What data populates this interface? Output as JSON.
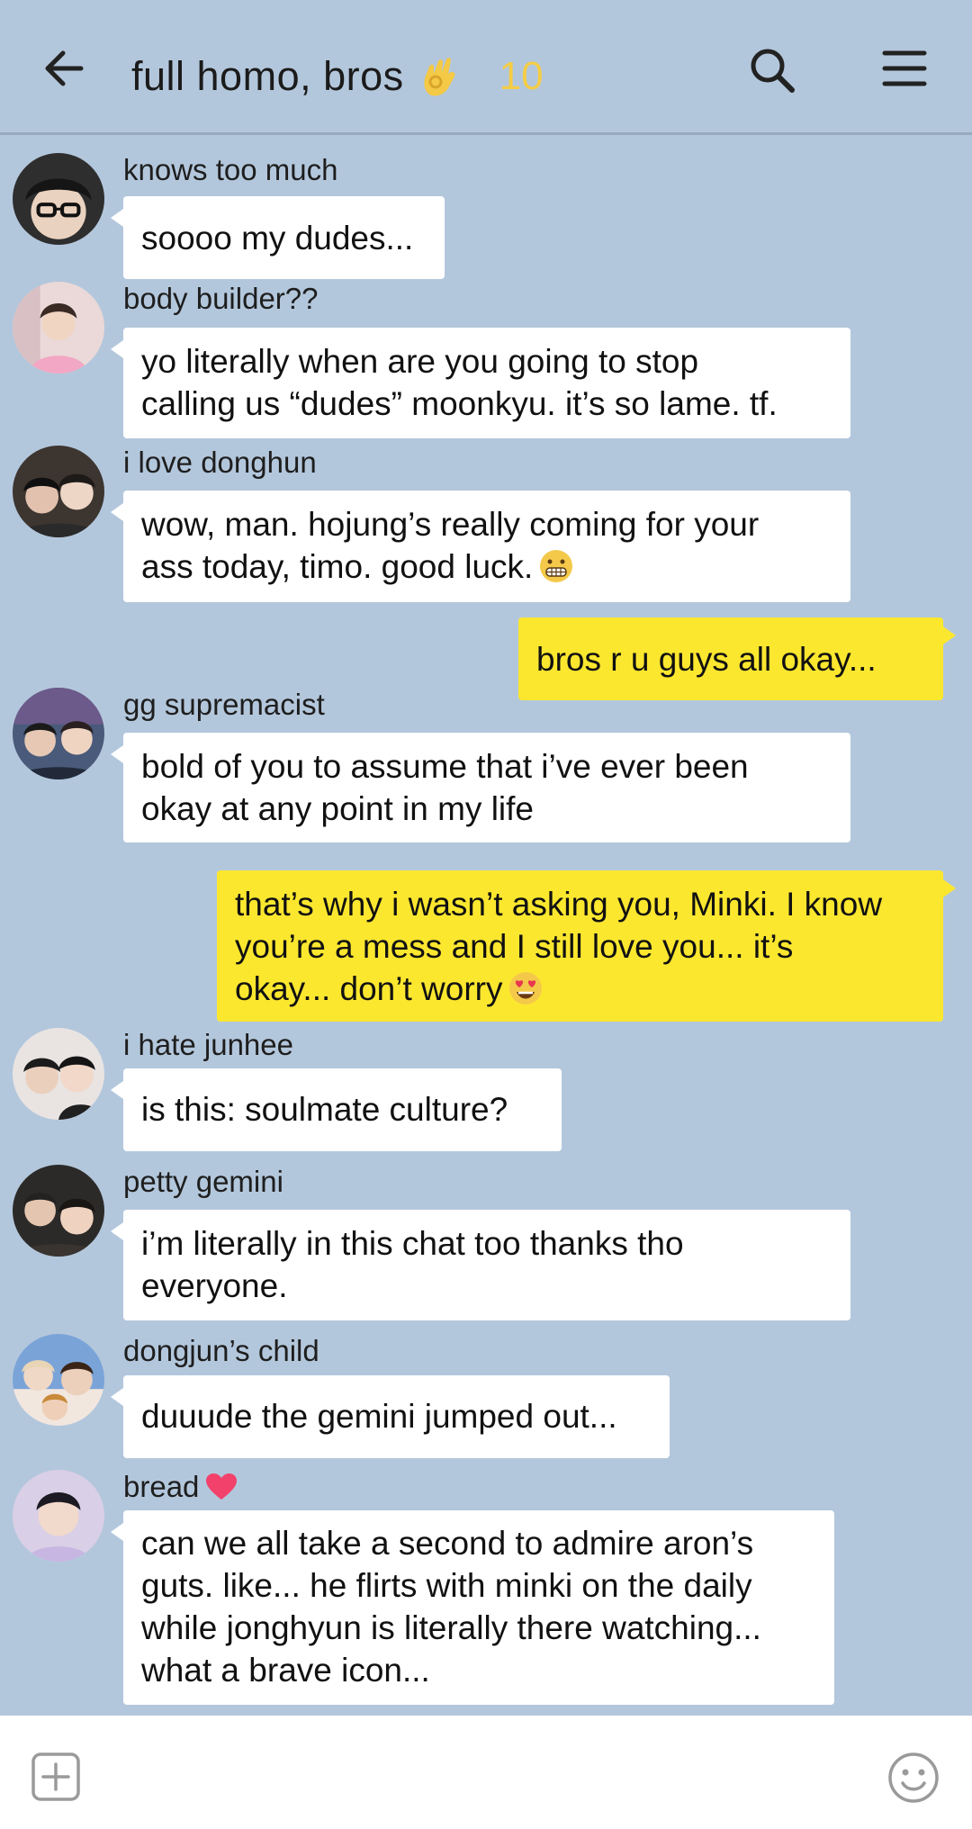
{
  "header": {
    "title": "full homo, bros",
    "member_count": "10",
    "back_icon": "arrow-left-icon",
    "search_icon": "search-icon",
    "menu_icon": "hamburger-menu-icon",
    "accent_color": "#f5cd45"
  },
  "colors": {
    "background": "#b3c7dc",
    "incoming_bubble": "#ffffff",
    "outgoing_bubble": "#fce72f"
  },
  "messages": [
    {
      "sender": "knows too much",
      "lines": [
        "soooo my dudes..."
      ]
    },
    {
      "sender": "body builder??",
      "lines": [
        "yo literally when are you going to stop",
        "calling us “dudes” moonkyu. it’s so lame. tf."
      ]
    },
    {
      "sender": "i love donghun",
      "lines": [
        "wow, man. hojung’s really coming for your",
        "ass today, timo. good luck."
      ]
    },
    {
      "outgoing": true,
      "lines": [
        "bros r u guys all okay..."
      ]
    },
    {
      "sender": "gg supremacist",
      "lines": [
        "bold of you to assume that i’ve ever been",
        "okay at any point in my life"
      ]
    },
    {
      "outgoing": true,
      "lines": [
        "that’s why i wasn’t asking you, Minki. I know",
        "you’re a mess and I still love you... it’s",
        "okay... don’t worry"
      ]
    },
    {
      "sender": "i hate junhee",
      "lines": [
        "is this: soulmate culture?"
      ]
    },
    {
      "sender": "petty gemini",
      "lines": [
        "i’m literally in this chat too thanks tho",
        "everyone."
      ]
    },
    {
      "sender": "dongjun’s child",
      "lines": [
        "duuude the gemini jumped out..."
      ]
    },
    {
      "sender": "bread",
      "lines": [
        "can we all take a second to admire aron’s",
        "guts. like... he flirts with minki on the daily",
        "while jonghyun is literally there watching...",
        "what a brave icon..."
      ]
    }
  ],
  "footer": {
    "attach_icon": "plus-box-icon",
    "emoji_icon": "smiley-icon"
  }
}
